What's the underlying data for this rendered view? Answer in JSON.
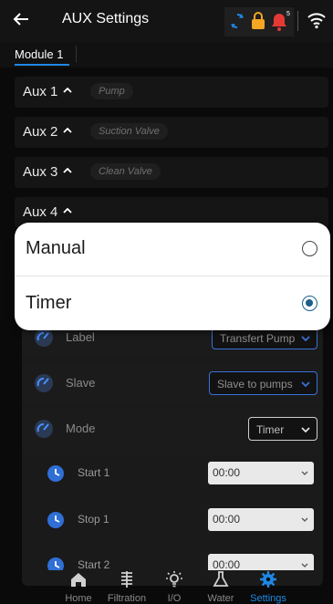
{
  "header": {
    "title": "AUX Settings",
    "notification_count": "5"
  },
  "module_tab": "Module 1",
  "aux_list": [
    {
      "label": "Aux 1",
      "tag": "Pump"
    },
    {
      "label": "Aux 2",
      "tag": "Suction Valve"
    },
    {
      "label": "Aux 3",
      "tag": "Clean Valve"
    },
    {
      "label": "Aux 4",
      "tag": ""
    }
  ],
  "mode_modal": {
    "options": [
      {
        "label": "Manual",
        "selected": false
      },
      {
        "label": "Timer",
        "selected": true
      }
    ],
    "accent": "#1c5f8a"
  },
  "settings": {
    "label": {
      "label": "Label",
      "value": "Transfert Pump"
    },
    "slave": {
      "label": "Slave",
      "value": "Slave to pumps"
    },
    "mode": {
      "label": "Mode",
      "value": "Timer"
    }
  },
  "schedule": [
    {
      "label": "Start 1",
      "value": "00:00"
    },
    {
      "label": "Stop 1",
      "value": "00:00"
    },
    {
      "label": "Start 2",
      "value": "00:00"
    }
  ],
  "nav": [
    {
      "label": "Home",
      "icon": "home-icon"
    },
    {
      "label": "Filtration",
      "icon": "filtration-icon"
    },
    {
      "label": "I/O",
      "icon": "lightbulb-icon"
    },
    {
      "label": "Water",
      "icon": "flask-icon"
    },
    {
      "label": "Settings",
      "icon": "gear-icon",
      "active": true
    }
  ],
  "colors": {
    "accent": "#1e88e5",
    "status_icon": "#f5a623",
    "bell": "#e53935"
  }
}
